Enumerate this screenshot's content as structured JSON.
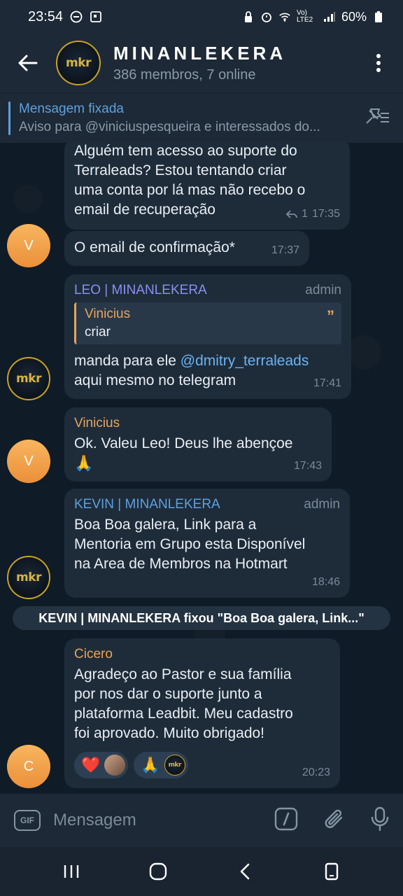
{
  "status": {
    "time": "23:54",
    "network": "Vo) LTE2",
    "battery": "60%"
  },
  "header": {
    "title": "MINANLEKERA",
    "subtitle": "386 membros, 7 online",
    "avatar_text": "mkr"
  },
  "pinned": {
    "title": "Mensagem fixada",
    "body": "Aviso para @viniciuspesqueira e interessados do..."
  },
  "messages": [
    {
      "text": "Alguém tem acesso ao suporte do\nTerraleads? Estou tentando criar\numa conta por lá mas não recebo o\nemail de recuperação",
      "replies": "1",
      "time": "17:35"
    },
    {
      "avatar": "V",
      "text": "O email de confirmação*",
      "time": "17:37"
    },
    {
      "sender": "LEO | MINANLEKERA",
      "role": "admin",
      "quote_name": "Vinicius",
      "quote_text": "criar",
      "quote_mark": "”",
      "text_before": "manda para ele ",
      "mention": "@dmitry_terraleads",
      "text_after": "aqui mesmo no telegram",
      "time": "17:41",
      "avatar": "mkr"
    },
    {
      "sender": "Vinicius",
      "text": "Ok. Valeu Leo! Deus lhe abençoe",
      "emoji": "🙏",
      "time": "17:43",
      "avatar": "V"
    },
    {
      "sender": "KEVIN | MINANLEKERA",
      "role": "admin",
      "text": "Boa Boa galera, Link para a\nMentoria em Grupo esta Disponível\nna Area de Membros na Hotmart",
      "time": "18:46",
      "avatar": "mkr"
    },
    {
      "sender": "Cicero",
      "text": "Agradeço ao Pastor e sua família\npor nos dar o suporte junto a\nplataforma Leadbit. Meu cadastro\nfoi aprovado. Muito obrigado!",
      "time": "20:23",
      "avatar": "C",
      "reactions": [
        {
          "emoji": "❤️"
        },
        {
          "emoji": "🙏",
          "avatar_text": "mkr"
        }
      ]
    }
  ],
  "service_message": "KEVIN | MINANLEKERA fixou \"Boa Boa galera, Link...\"",
  "input": {
    "placeholder": "Mensagem",
    "gif_label": "GIF"
  },
  "colors": {
    "background": "#0f1b26",
    "header": "#1d2936",
    "bubble": "#1e2c3a",
    "accent": "#5ea0dd",
    "sender_leo": "#8a8ff0",
    "sender_vinicius": "#e8a45b",
    "sender_kevin": "#5ea0dd",
    "sender_cicero": "#e8a45b",
    "avatar_orange": "#ec8f3a",
    "logo_gold": "#c9a227"
  },
  "icons": {
    "back": "arrow-left-icon",
    "menu": "more-vertical-icon",
    "pinned_list": "pinned-list-icon",
    "slash": "slash-command-icon",
    "attach": "paperclip-icon",
    "mic": "microphone-icon"
  }
}
